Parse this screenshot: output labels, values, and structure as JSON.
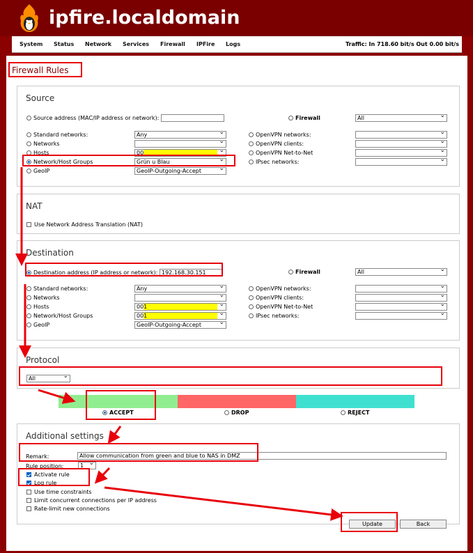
{
  "header": {
    "hostname": "ipfire.localdomain"
  },
  "menu": [
    "System",
    "Status",
    "Network",
    "Services",
    "Firewall",
    "IPFire",
    "Logs"
  ],
  "traffic": {
    "text": "Traffic: In 718.60 bit/s   Out 0.00 bit/s"
  },
  "page": {
    "title": "Firewall Rules"
  },
  "source": {
    "title": "Source",
    "address_label": "Source address (MAC/IP address or network):",
    "address_value": "",
    "firewall_label": "Firewall",
    "firewall_select": "All",
    "rows": [
      "Standard networks:",
      "Networks",
      "Hosts",
      "Network/Host Groups",
      "GeoIP"
    ],
    "selects": [
      "Any",
      "",
      "00",
      "Grün u Blau",
      "GeoIP-Outgoing-Accept"
    ],
    "vpn_rows": [
      "OpenVPN networks:",
      "OpenVPN clients:",
      "OpenVPN Net-to-Net",
      "IPsec networks:"
    ]
  },
  "nat": {
    "title": "NAT",
    "label": "Use Network Address Translation (NAT)"
  },
  "destination": {
    "title": "Destination",
    "address_label": "Destination address (IP address or network):",
    "address_value": "192.168.30.151",
    "firewall_label": "Firewall",
    "firewall_select": "All",
    "rows": [
      "Standard networks:",
      "Networks",
      "Hosts",
      "Network/Host Groups",
      "GeoIP"
    ],
    "selects": [
      "Any",
      "",
      "001",
      "001",
      "GeoIP-Outgoing-Accept"
    ],
    "vpn_rows": [
      "OpenVPN networks:",
      "OpenVPN clients:",
      "OpenVPN Net-to-Net",
      "IPsec networks:"
    ]
  },
  "protocol": {
    "title": "Protocol",
    "select": "All"
  },
  "policy": {
    "accept": "ACCEPT",
    "drop": "DROP",
    "reject": "REJECT",
    "colors": {
      "accept": "#90ee90",
      "drop": "#ff6666",
      "reject": "#40e0d0"
    }
  },
  "additional": {
    "title": "Additional settings",
    "remark_label": "Remark:",
    "remark_value": "Allow communication from green and blue to NAS in DMZ",
    "position_label": "Rule position:",
    "position_value": "1",
    "checks": [
      "Activate rule",
      "Log rule",
      "Use time constraints",
      "Limit concurrent connections per IP address",
      "Rate-limit new connections"
    ]
  },
  "buttons": {
    "update": "Update",
    "back": "Back"
  },
  "colors": {
    "brand": "#8b0000",
    "annotation": "#e8000b",
    "highlight": "#ffff00",
    "radio_selected": "#0060c0"
  }
}
